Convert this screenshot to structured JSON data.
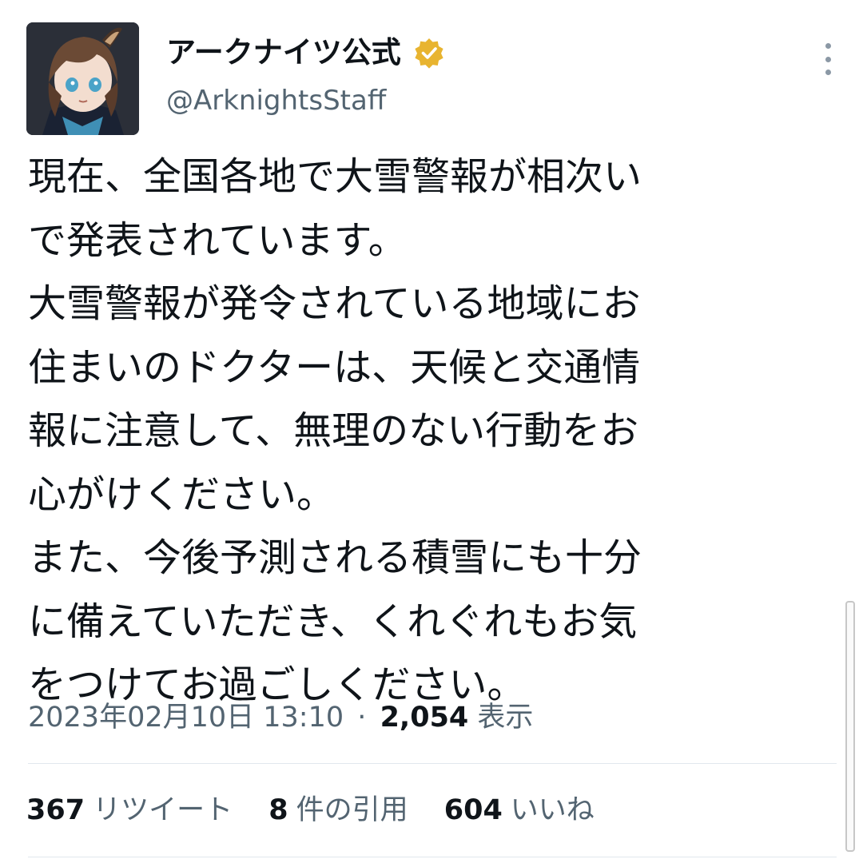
{
  "user": {
    "display_name": "アークナイツ公式",
    "handle": "@ArknightsStaff",
    "verified_badge_icon": "verified-badge-icon",
    "badge_color": "#e8b430"
  },
  "tweet": {
    "lines": [
      "現在、全国各地で大雪警報が相次い",
      "で発表されています。",
      "大雪警報が発令されている地域にお",
      "住まいのドクターは、天候と交通情",
      "報に注意して、無理のない行動をお",
      "心がけください。",
      "また、今後予測される積雪にも十分",
      "に備えていただき、くれぐれもお気",
      "をつけてお過ごしください。"
    ]
  },
  "meta": {
    "timestamp": "2023年02月10日 13:10",
    "separator": "·",
    "views_count": "2,054",
    "views_label": "表示"
  },
  "stats": {
    "retweets_count": "367",
    "retweets_label": "リツイート",
    "quotes_count": "8",
    "quotes_label": "件の引用",
    "likes_count": "604",
    "likes_label": "いいね"
  },
  "colors": {
    "text": "#0f1419",
    "secondary": "#536471",
    "divider": "#e1e8ed"
  }
}
